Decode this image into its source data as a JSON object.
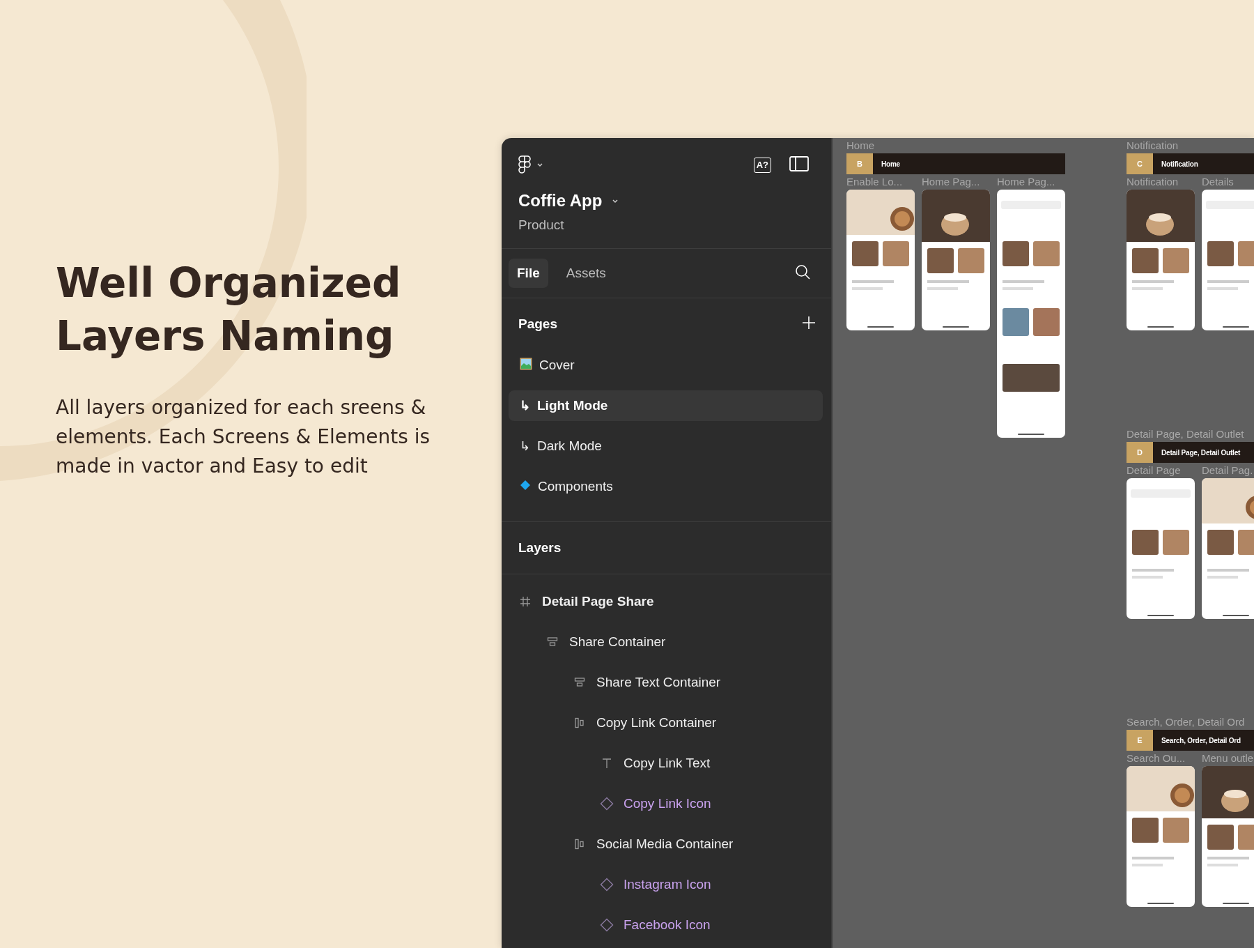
{
  "hero": {
    "title": "Well Organized Layers Naming",
    "description": "All layers organized for each sreens & elements. Each Screens & Elements is made in vactor and Easy to edit"
  },
  "sidebar": {
    "ai_button": "A?",
    "file_name": "Coffie App",
    "file_subtitle": "Product",
    "tabs": [
      {
        "label": "File",
        "selected": true
      },
      {
        "label": "Assets",
        "selected": false
      }
    ],
    "pages_title": "Pages",
    "pages": [
      {
        "label": "Cover",
        "kind": "cover",
        "selected": false
      },
      {
        "label": "Light Mode",
        "kind": "subpage",
        "prefix": "↳",
        "selected": true
      },
      {
        "label": "Dark Mode",
        "kind": "subpage",
        "prefix": "↳",
        "selected": false
      },
      {
        "label": "Components",
        "kind": "component",
        "selected": false
      }
    ],
    "layers_title": "Layers",
    "layers": [
      {
        "label": "Detail Page Share",
        "kind": "frame",
        "children": [
          {
            "label": "Share Container",
            "kind": "vstack",
            "children": [
              {
                "label": "Share Text Container",
                "kind": "vstack"
              },
              {
                "label": "Copy Link Container",
                "kind": "hstack",
                "children": [
                  {
                    "label": "Copy Link Text",
                    "kind": "text"
                  },
                  {
                    "label": "Copy Link Icon",
                    "kind": "instance"
                  }
                ]
              },
              {
                "label": "Social Media Container",
                "kind": "hstack",
                "children": [
                  {
                    "label": "Instagram Icon",
                    "kind": "instance"
                  },
                  {
                    "label": "Facebook Icon",
                    "kind": "instance"
                  }
                ]
              }
            ]
          }
        ]
      }
    ]
  },
  "canvas": {
    "sections": [
      {
        "label": "Home",
        "tag": "B",
        "title": "Home",
        "frames": [
          {
            "label": "Enable Lo...",
            "kind": "screen"
          },
          {
            "label": "Home Pag...",
            "kind": "screen"
          },
          {
            "label": "Home Pag...",
            "kind": "long-screen"
          }
        ]
      },
      {
        "label": "Notification",
        "tag": "C",
        "title": "Notification",
        "frames": [
          {
            "label": "Notification",
            "kind": "screen"
          },
          {
            "label": "Details",
            "kind": "screen"
          }
        ]
      },
      {
        "label": "Detail Page, Detail Outlet",
        "tag": "D",
        "title": "Detail Page, Detail Outlet",
        "frames": [
          {
            "label": "Detail Page",
            "kind": "screen"
          },
          {
            "label": "Detail Pag.",
            "kind": "screen"
          }
        ]
      },
      {
        "label": "Search, Order, Detail Ord",
        "tag": "E",
        "title": "Search, Order, Detail Ord",
        "frames": [
          {
            "label": "Search Ou...",
            "kind": "screen"
          },
          {
            "label": "Menu outle",
            "kind": "screen"
          }
        ]
      }
    ]
  }
}
